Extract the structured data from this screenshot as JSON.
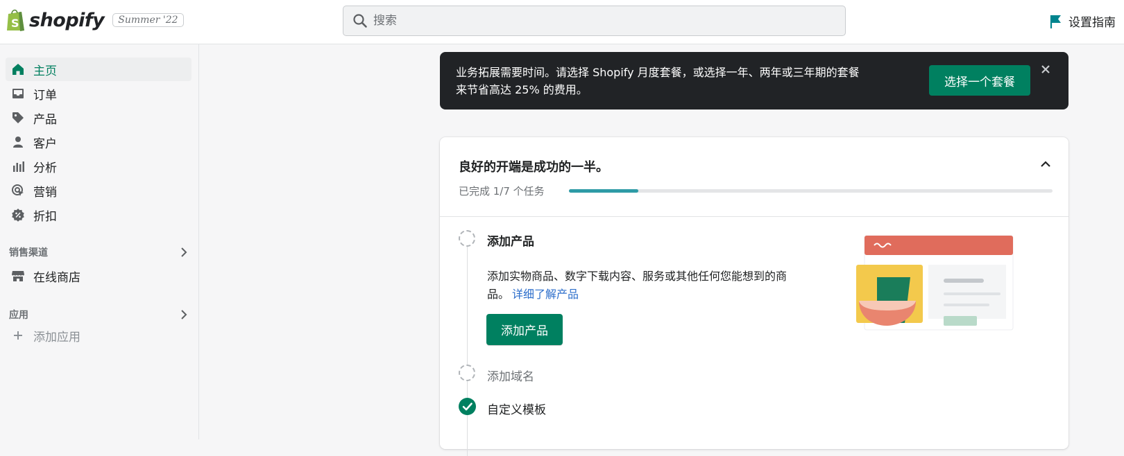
{
  "brand": {
    "name": "shopify",
    "edition": "Summer '22"
  },
  "search": {
    "placeholder": "搜索"
  },
  "header": {
    "setup_guide_label": "设置指南"
  },
  "sidebar": {
    "items": [
      {
        "label": "主页",
        "icon": "home-icon",
        "active": true
      },
      {
        "label": "订单",
        "icon": "inbox-icon"
      },
      {
        "label": "产品",
        "icon": "tag-icon"
      },
      {
        "label": "客户",
        "icon": "person-icon"
      },
      {
        "label": "分析",
        "icon": "bar-chart-icon"
      },
      {
        "label": "营销",
        "icon": "target-icon"
      },
      {
        "label": "折扣",
        "icon": "discount-icon"
      }
    ],
    "sales_channels": {
      "heading": "销售渠道",
      "items": [
        {
          "label": "在线商店",
          "icon": "store-icon"
        }
      ]
    },
    "apps": {
      "heading": "应用",
      "add_label": "添加应用"
    }
  },
  "banner": {
    "line1": "业务拓展需要时间。请选择 Shopify 月度套餐，或选择一年、两年或三年期的套餐",
    "line2": "来节省高达 25% 的费用。",
    "button_label": "选择一个套餐"
  },
  "setup_card": {
    "title": "良好的开端是成功的一半。",
    "progress_text": "已完成 1/7 个任务",
    "progress_completed": 1,
    "progress_total": 7,
    "steps": [
      {
        "title": "添加产品",
        "status": "pending",
        "desc_line1": "添加实物商品、数字下载内容、服务或其他任何您能想到的商",
        "desc_line2": "品。",
        "link_label": "详细了解产品",
        "button_label": "添加产品"
      },
      {
        "title": "添加域名",
        "status": "pending"
      },
      {
        "title": "自定义模板",
        "status": "completed"
      }
    ]
  },
  "colors": {
    "accent": "#008060",
    "active_nav": "#007f5f",
    "link": "#2c6ecb",
    "progress": "#2e9ba6",
    "banner_bg": "#212326"
  }
}
